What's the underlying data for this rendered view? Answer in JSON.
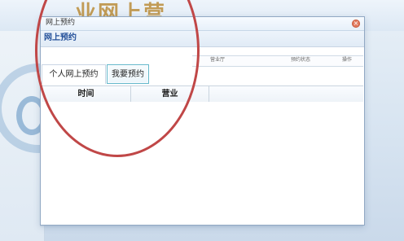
{
  "background": {
    "title": "业网上营"
  },
  "modal": {
    "title": "网上预约",
    "close_label": "×",
    "section_title": "网上预约",
    "tabs": [
      {
        "label": "个人网上预约"
      },
      {
        "label": "我要预约"
      }
    ],
    "table": {
      "headers": [
        "时间",
        "营业"
      ],
      "right_headers": [
        "营业厅",
        "预约状态",
        "操作"
      ]
    }
  }
}
